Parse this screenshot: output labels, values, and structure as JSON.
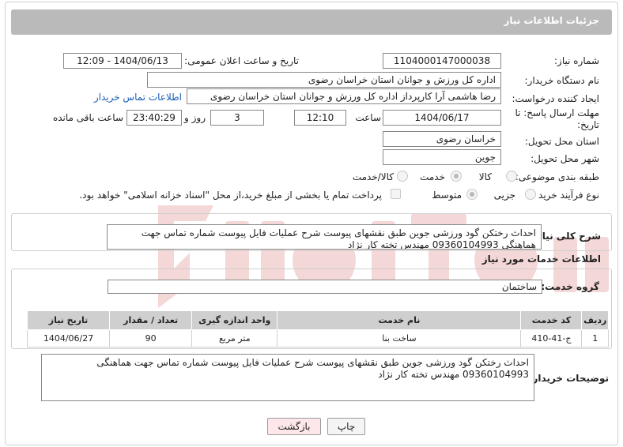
{
  "header": {
    "title": "جزئیات اطلاعات نیاز"
  },
  "form": {
    "need_number_label": "شماره نیاز:",
    "need_number": "1104000147000038",
    "announce_label": "تاریخ و ساعت اعلان عمومی:",
    "announce_value": "1404/06/13 - 12:09",
    "buyer_org_label": "نام دستگاه خریدار:",
    "buyer_org": "اداره کل ورزش و جوانان استان خراسان رضوی",
    "requester_label": "ایجاد کننده درخواست:",
    "requester": "رضا هاشمی آرا کارپرداز اداره کل ورزش و جوانان استان خراسان رضوی",
    "contact_link": "اطلاعات تماس خریدار",
    "deadline_label_1": "مهلت ارسال پاسخ: تا",
    "deadline_label_2": "تاریخ:",
    "deadline_date": "1404/06/17",
    "time_label": "ساعت",
    "deadline_time": "12:10",
    "days_value": "3",
    "days_label": "روز و",
    "remaining_time": "23:40:29",
    "remaining_label": "ساعت باقی مانده",
    "province_label": "استان محل تحویل:",
    "province": "خراسان رضوی",
    "city_label": "شهر محل تحویل:",
    "city": "جوین",
    "category_label": "طبقه بندی موضوعی:",
    "category_options": [
      "کالا",
      "خدمت",
      "کالا/خدمت"
    ],
    "process_label": "نوع فرآیند خرید :",
    "process_options": [
      "جزیی",
      "متوسط"
    ],
    "payment_note": "پرداخت تمام یا بخشی از مبلغ خرید،از محل \"اسناد خزانه اسلامی\" خواهد بود."
  },
  "summary": {
    "label": "شرح کلی نیاز:",
    "text": "احداث رختکن گود ورزشی جوین طبق نقشهای پیوست شرح عملیات فایل پیوست شماره تماس جهت هماهنگی 09360104993 مهندس تخته کار نژاد"
  },
  "services": {
    "section_title": "اطلاعات خدمات مورد نیاز",
    "group_label": "گروه خدمت:",
    "group_value": "ساختمان",
    "columns": [
      "ردیف",
      "کد خدمت",
      "نام خدمت",
      "واحد اندازه گیری",
      "تعداد / مقدار",
      "تاریخ نیاز"
    ],
    "rows": [
      [
        "1",
        "ج-41-410",
        "ساخت بنا",
        "متر مربع",
        "90",
        "1404/06/27"
      ]
    ]
  },
  "buyer_notes": {
    "label": "توضیحات خریدار:",
    "text": "احداث رختکن گود ورزشی جوین طبق نقشهای پیوست شرح عملیات فایل پیوست شماره تماس جهت هماهنگی 09360104993 مهندس تخته کار نژاد"
  },
  "buttons": {
    "print": "چاپ",
    "back": "بازگشت"
  },
  "colors": {
    "header_bg": "#bababa",
    "table_header_bg": "#cfcfcf",
    "back_bg": "#fde7ea",
    "link": "#1a5fb4"
  }
}
